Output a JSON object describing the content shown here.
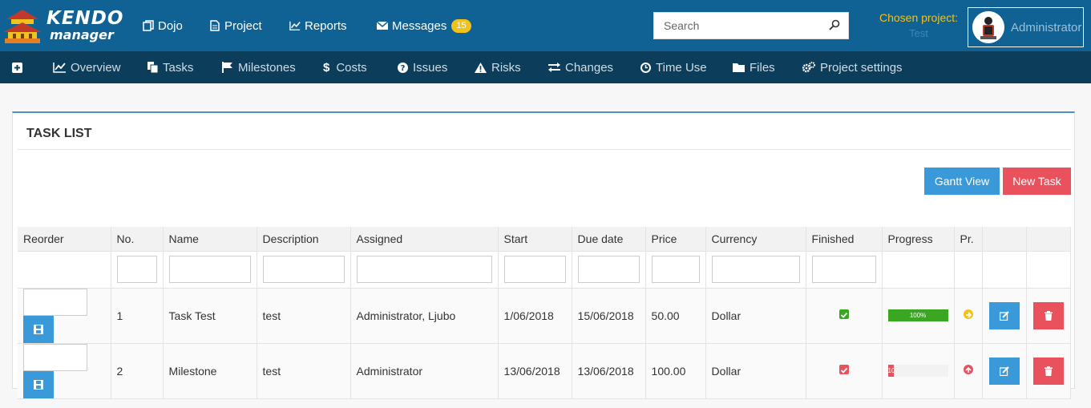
{
  "app": {
    "logo_text_1": "KENDO",
    "logo_text_2": "manager"
  },
  "topnav": {
    "dojo": "Dojo",
    "project": "Project",
    "reports": "Reports",
    "messages": "Messages",
    "messages_count": "15"
  },
  "search": {
    "placeholder": "Search"
  },
  "chosen_project": {
    "label": "Chosen project:",
    "value": "Test"
  },
  "user": {
    "name": "Administrator"
  },
  "subnav": {
    "overview": "Overview",
    "tasks": "Tasks",
    "milestones": "Milestones",
    "costs": "Costs",
    "issues": "Issues",
    "risks": "Risks",
    "changes": "Changes",
    "time_use": "Time Use",
    "files": "Files",
    "project_settings": "Project settings"
  },
  "panel": {
    "title": "TASK LIST",
    "gantt_button": "Gantt View",
    "new_task_button": "New Task"
  },
  "table": {
    "headers": {
      "reorder": "Reorder",
      "no": "No.",
      "name": "Name",
      "description": "Description",
      "assigned": "Assigned",
      "start": "Start",
      "due": "Due date",
      "price": "Price",
      "currency": "Currency",
      "finished": "Finished",
      "progress": "Progress",
      "priority": "Pr."
    },
    "rows": [
      {
        "no": "1",
        "name": "Task Test",
        "description": "test",
        "assigned": "Administrator, Ljubo",
        "start": "1/06/2018",
        "due": "15/06/2018",
        "price": "50.00",
        "currency": "Dollar",
        "finished": true,
        "progress": 100,
        "progress_label": "100%",
        "priority_color": "#f0c21b"
      },
      {
        "no": "2",
        "name": "Milestone",
        "description": "test",
        "assigned": "Administrator",
        "start": "13/06/2018",
        "due": "13/06/2018",
        "price": "100.00",
        "currency": "Dollar",
        "finished": false,
        "progress": 10,
        "progress_label": "10",
        "priority_color": "#e9525d"
      }
    ]
  },
  "colors": {
    "topbar": "#0f6293",
    "subnav": "#0c3e5c",
    "accent_blue": "#3a9ad9",
    "accent_red": "#e9525d",
    "accent_yellow": "#f0c21b",
    "progress_green": "#3aa622"
  }
}
